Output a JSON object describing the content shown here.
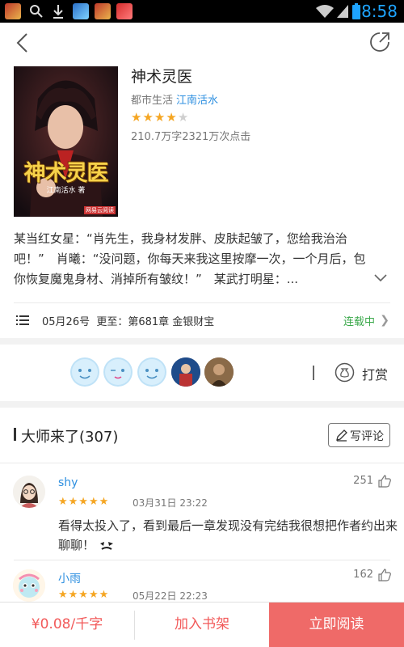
{
  "status_bar": {
    "time": "8:58",
    "icons": [
      "app-icon",
      "search-icon",
      "download-icon",
      "app-icon",
      "app-icon",
      "app-icon",
      "wifi-icon",
      "signal-icon",
      "battery-icon"
    ]
  },
  "book": {
    "title": "神术灵医",
    "category": "都市生活",
    "author": "江南活水",
    "rating": 4,
    "rating_max": 5,
    "stats": "210.7万字2321万次点击",
    "cover_title": "神术灵医",
    "cover_author": "江南活水 著",
    "cover_publisher": "网易云阅读",
    "synopsis": "某当红女星：“肖先生，我身材发胖、皮肤起皱了，您给我治治吧！”　肖曦：“没问题，你每天来我这里按摩一次，一个月后，包你恢复魔鬼身材、消掉所有皱纹！”　某武打明星：..."
  },
  "update": {
    "text": "05月26号  更至：第681章 金银财宝",
    "status": "连载中"
  },
  "tip": {
    "label": "打赏",
    "avatars": [
      "emoji-face",
      "emoji-face-wink",
      "emoji-face",
      "photo",
      "photo"
    ]
  },
  "comments_section": {
    "title": "大师来了(307)",
    "write_label": "写评论"
  },
  "comments": [
    {
      "name": "shy",
      "likes": "251",
      "rating": 5,
      "date": "03月31日 23:22",
      "text": "看得太投入了，看到最后一章发现没有完结我很想把作者约出来聊聊！"
    },
    {
      "name": "小雨",
      "likes": "162",
      "rating": 5,
      "date": "05月22日 22:23",
      "text": ""
    }
  ],
  "bottom_bar": {
    "price": "¥0.08/千字",
    "add_shelf": "加入书架",
    "read_now": "立即阅读"
  },
  "colors": {
    "accent": "#ef6a68",
    "link": "#2d8fe0",
    "star": "#f5a623",
    "serial": "#3aa84a",
    "time": "#1ea4ff"
  }
}
